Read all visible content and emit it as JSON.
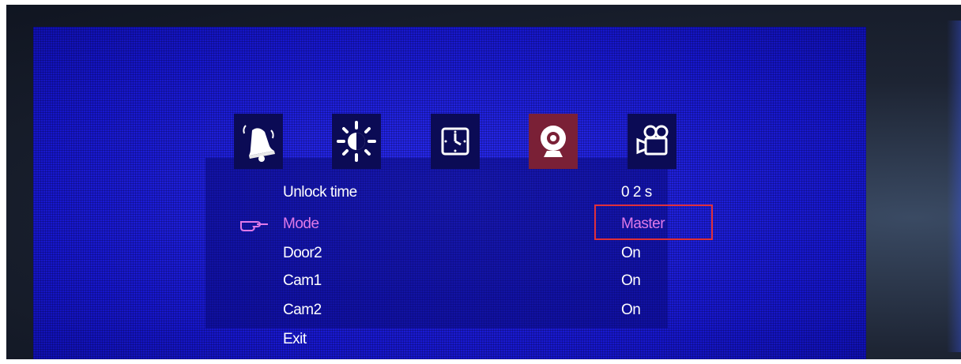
{
  "icons": [
    {
      "name": "bell-icon",
      "selected": false
    },
    {
      "name": "brightness-icon",
      "selected": false
    },
    {
      "name": "clock-icon",
      "selected": false
    },
    {
      "name": "webcam-icon",
      "selected": true
    },
    {
      "name": "video-camera-icon",
      "selected": false
    }
  ],
  "menu": {
    "rows": [
      {
        "label": "Unlock time",
        "value": "0 2 s"
      },
      {
        "label": "Mode",
        "value": "Master"
      },
      {
        "label": "Door2",
        "value": "On"
      },
      {
        "label": "Cam1",
        "value": "On"
      },
      {
        "label": "Cam2",
        "value": "On"
      },
      {
        "label": "Exit",
        "value": ""
      }
    ],
    "active_row": "Mode"
  },
  "colors": {
    "screen_blue": "#1616d6",
    "selected_tile": "#7a2036",
    "active_text": "#e07ae8",
    "highlight_box": "#e0303a"
  }
}
